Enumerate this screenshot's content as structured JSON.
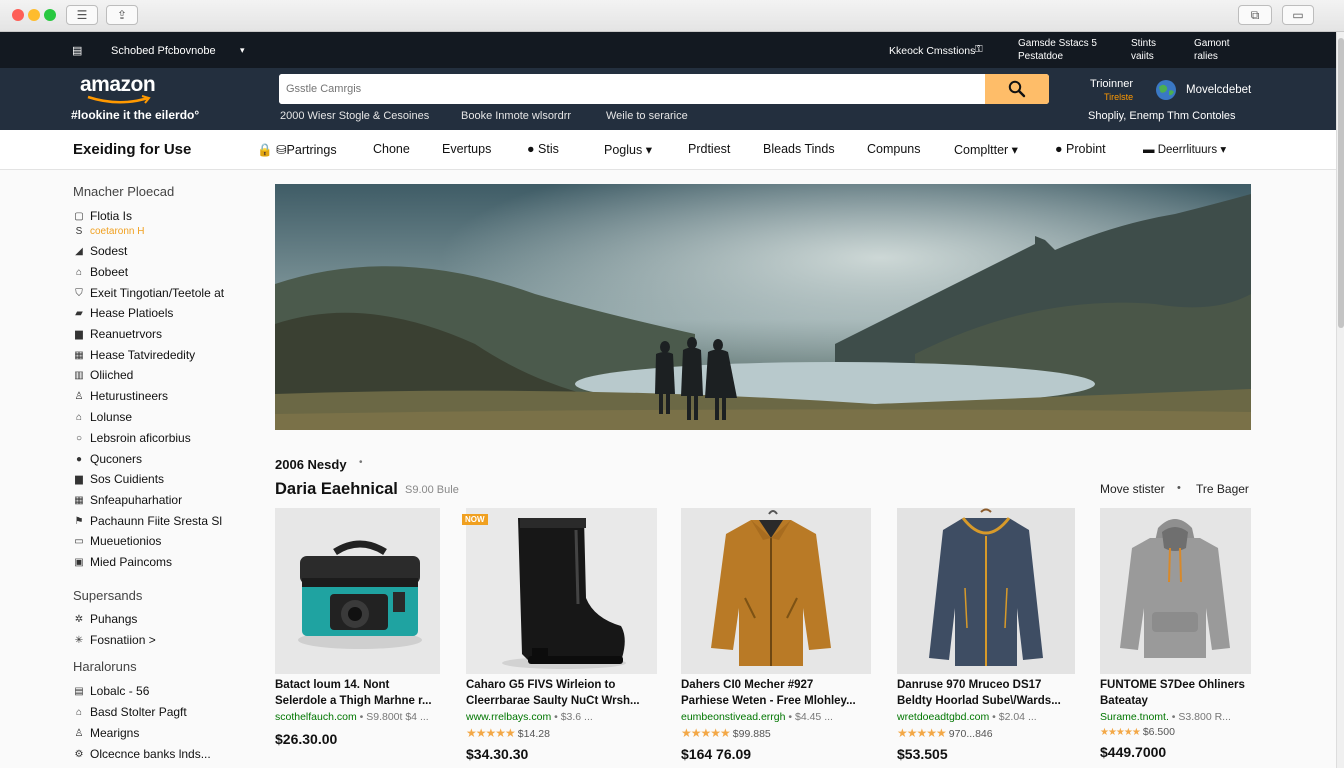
{
  "browser": {
    "sidebar_icon": "sidebar-icon",
    "share_icon": "share-icon"
  },
  "topstrip": {
    "left_label": "Schobed Pfcbovnobe",
    "center_label": "Kkeock Cmsstions",
    "col1_line1": "Gamsde Sstacs 5",
    "col1_line2": "Pestatdoe",
    "col2_line1": "Stints",
    "col2_line2": "vaiits",
    "col3_line1": "Gamont",
    "col3_line2": "ralies"
  },
  "header": {
    "logo": "amazon",
    "tagline": "#lookine it the eilerdo°",
    "search_placeholder": "Gsstle Camrgis",
    "promo_links": [
      "2000 Wiesr Stogle & Cesoines",
      "Booke Inmote wlsordrr",
      "Weile to serarice"
    ],
    "account_top": "Trioinner",
    "account_badge": "Tirelste",
    "globe_label": "Movelcdebet",
    "right_bottom": "Shopliy, Enemp Thm Contoles"
  },
  "categories": {
    "title": "Exeiding for Use",
    "items": [
      {
        "label": "Partrings"
      },
      {
        "label": "Chone"
      },
      {
        "label": "Evertups"
      },
      {
        "label": "Stis"
      },
      {
        "label": "Poglus"
      },
      {
        "label": "Prdtiest"
      },
      {
        "label": "Bleads Tinds"
      },
      {
        "label": "Compuns"
      },
      {
        "label": "Compltter"
      },
      {
        "label": "Probint"
      },
      {
        "label": "Deerrlituurs"
      }
    ]
  },
  "sidebar": {
    "heading1": "Mnacher Ploecad",
    "items1": [
      {
        "label": "Flotia Is"
      },
      {
        "label": "coetaronn H"
      },
      {
        "label": "Sodest"
      },
      {
        "label": "Bobeet"
      },
      {
        "label": "Exeit Tingotian/Teetole at"
      },
      {
        "label": "Hease Platioels"
      },
      {
        "label": "Reanuetrvors"
      },
      {
        "label": "Hease Tatvirededity"
      },
      {
        "label": "Oliiched"
      },
      {
        "label": "Heturustineers"
      },
      {
        "label": "Lolunse"
      },
      {
        "label": "Lebsroin aficorbius"
      },
      {
        "label": "Quconers"
      },
      {
        "label": "Sos Cuidients"
      },
      {
        "label": "Snfeapuharhatior"
      },
      {
        "label": "Pachaunn Fiite Sresta Sl"
      },
      {
        "label": "Mueuetionios"
      },
      {
        "label": "Mied Paincoms"
      }
    ],
    "heading2": "Supersands",
    "items2": [
      {
        "label": "Puhangs"
      },
      {
        "label": "Fosnatiion >"
      }
    ],
    "heading3": "Haraloruns",
    "items3": [
      {
        "label": "Lobalc - 56"
      },
      {
        "label": "Basd Stolter Pagft"
      },
      {
        "label": "Mearigns"
      },
      {
        "label": "Olcecnce banks lnds..."
      }
    ]
  },
  "deals": {
    "small_heading": "2006 Nesdy",
    "heading": "Daria Eaehnical",
    "sub": "S9.00 Bule",
    "right1": "Move stister",
    "right2": "Tre Bager"
  },
  "products": [
    {
      "title1": "Batact loum 14. Nont",
      "title2": "Selerdole a Thigh Marhne r...",
      "shop": "scothelfauch.com",
      "shop_tail": "• S9.800t $4 ...",
      "stars": "",
      "count": "",
      "price": "$26.30.00",
      "badge": ""
    },
    {
      "title1": "Caharo G5 FIVS Wirleion to",
      "title2": "Cleerrbarae Saulty NuCt Wrsh...",
      "shop": "www.rrelbays.com",
      "shop_tail": "• $3.6 ...",
      "stars": "★★★★★",
      "count": "$14.28",
      "price": "$34.30.30",
      "badge": "NOW"
    },
    {
      "title1": "Dahers CI0 Mecher #927",
      "title2": "Parhiese Weten - Free Mlohley...",
      "shop": "eumbeonstivead.errgh",
      "shop_tail": "• $4.45 ...",
      "stars": "★★★★★",
      "count": "$99.885",
      "price": "$164 76.09",
      "badge": ""
    },
    {
      "title1": "Danruse 970 Mruceo DS17",
      "title2": "Beldty Hoorlad Sube\\/Wards...",
      "shop": "wretdoeadtgbd.com",
      "shop_tail": "• $2.04 ...",
      "stars": "★★★★★",
      "count": "970...846",
      "price": "$53.505",
      "badge": ""
    },
    {
      "title1": "FUNTOME S7Dee Ohliners",
      "title2": "Bateatay",
      "shop": "Surame.tnomt.",
      "shop_tail": "• S3.800 R...",
      "stars": "★★★★★",
      "count": "$6.500",
      "price": "$449.7000",
      "badge": ""
    }
  ],
  "colors": {
    "nav_dark": "#131921",
    "nav": "#232f3e",
    "search_button": "#febd69",
    "star": "#f3a847",
    "link_green": "#007600"
  }
}
